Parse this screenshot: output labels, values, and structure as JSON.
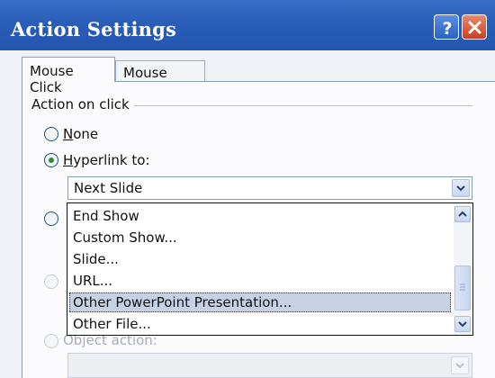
{
  "window": {
    "title": "Action Settings",
    "help_icon": "question-mark-icon",
    "close_icon": "close-x-icon"
  },
  "tabs": [
    {
      "label": "Mouse Click",
      "active": true
    },
    {
      "label": "Mouse Over",
      "active": false
    }
  ],
  "group": {
    "label": "Action on click"
  },
  "radios": {
    "none": {
      "accel": "N",
      "rest": "one",
      "checked": false
    },
    "hyperlink": {
      "accel": "H",
      "rest": "yperlink to:",
      "checked": true
    },
    "object_action": {
      "label_visible": "Object action:",
      "disabled": true
    }
  },
  "hyperlink_combo": {
    "value": "Next Slide"
  },
  "dropdown_options": [
    {
      "label": "End Show",
      "selected": false
    },
    {
      "label": "Custom Show...",
      "selected": false
    },
    {
      "label": "Slide...",
      "selected": false
    },
    {
      "label": "URL...",
      "selected": false
    },
    {
      "label": "Other PowerPoint Presentation...",
      "selected": true
    },
    {
      "label": "Other File...",
      "selected": false
    }
  ],
  "colors": {
    "titlebar": "#2a5db8",
    "selection": "#c7d1e6",
    "radio_dot": "#2e8b2e"
  }
}
